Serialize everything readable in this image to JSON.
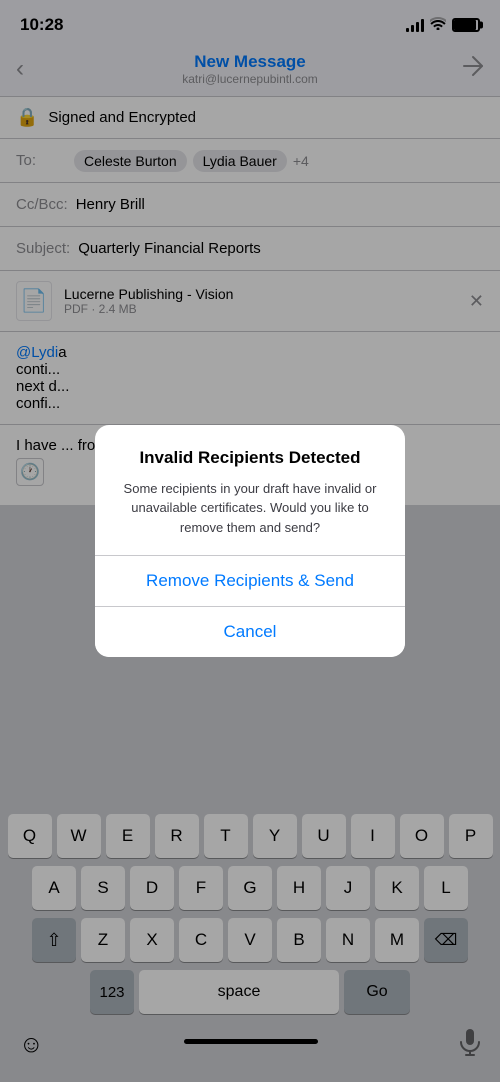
{
  "statusBar": {
    "time": "10:28"
  },
  "header": {
    "title": "New Message",
    "subtitle": "katri@lucernepubintl.com",
    "backLabel": "<",
    "sendLabel": "▷"
  },
  "security": {
    "label": "Signed and Encrypted"
  },
  "fields": {
    "toLabel": "To:",
    "toRecipients": [
      "Celeste Burton",
      "Lydia Bauer"
    ],
    "toMore": "+4",
    "ccBccLabel": "Cc/Bcc:",
    "ccBccValue": "Henry Brill",
    "subjectLabel": "Subject:",
    "subjectValue": "Quarterly Financial Reports"
  },
  "attachment": {
    "name": "Lucerne Publishing - Vision",
    "type": "PDF",
    "size": "PDF · 2.4 MB"
  },
  "body1": "@Lydia, continuing on the next draft confi...",
  "body2": "I have... from @Tim...",
  "alert": {
    "title": "Invalid Recipients Detected",
    "message": "Some recipients in your draft have invalid or unavailable certificates. Would you like to remove them and send?",
    "primaryButton": "Remove Recipients & Send",
    "cancelButton": "Cancel"
  },
  "keyboard": {
    "rows": [
      [
        "Q",
        "W",
        "E",
        "R",
        "T",
        "Y",
        "U",
        "I",
        "O",
        "P"
      ],
      [
        "A",
        "S",
        "D",
        "F",
        "G",
        "H",
        "J",
        "K",
        "L"
      ],
      [
        "⇧",
        "Z",
        "X",
        "C",
        "V",
        "B",
        "N",
        "M",
        "⌫"
      ]
    ],
    "bottomLeft": "123",
    "space": "space",
    "bottomRight": "Go",
    "emoji": "☺",
    "mic": "🎤"
  }
}
